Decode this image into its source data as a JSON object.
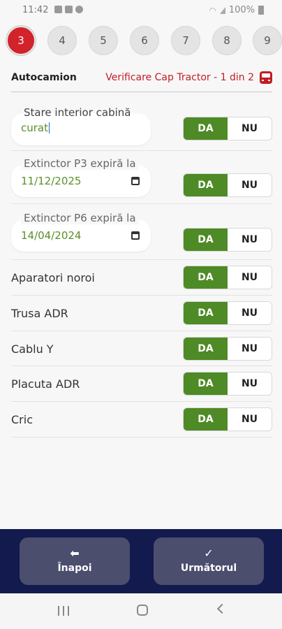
{
  "status_bar": {
    "time": "11:42",
    "battery": "100%"
  },
  "steps": [
    "3",
    "4",
    "5",
    "6",
    "7",
    "8",
    "9"
  ],
  "active_step": "3",
  "header": {
    "vehicle": "Autocamion",
    "check_title": "Verificare Cap Tractor - 1 din 2"
  },
  "fields": {
    "interior": {
      "label": "Stare interior cabină",
      "value": "curat"
    },
    "extinctor_p3": {
      "label": "Extinctor P3 expiră la",
      "value": "11/12/2025"
    },
    "extinctor_p6": {
      "label": "Extinctor P6 expiră la",
      "value": "14/04/2024"
    }
  },
  "items": {
    "aparatori": "Aparatori noroi",
    "trusa": "Trusa ADR",
    "cablu": "Cablu Y",
    "placuta": "Placuta ADR",
    "cric": "Cric"
  },
  "toggle": {
    "yes": "DA",
    "no": "NU"
  },
  "nav": {
    "back": "Înapoi",
    "next": "Următorul"
  },
  "colors": {
    "accent_red": "#d2232a",
    "yes_green": "#4e8a25",
    "bottom_bar": "#121a4e",
    "nav_button": "#4b4e6d"
  }
}
